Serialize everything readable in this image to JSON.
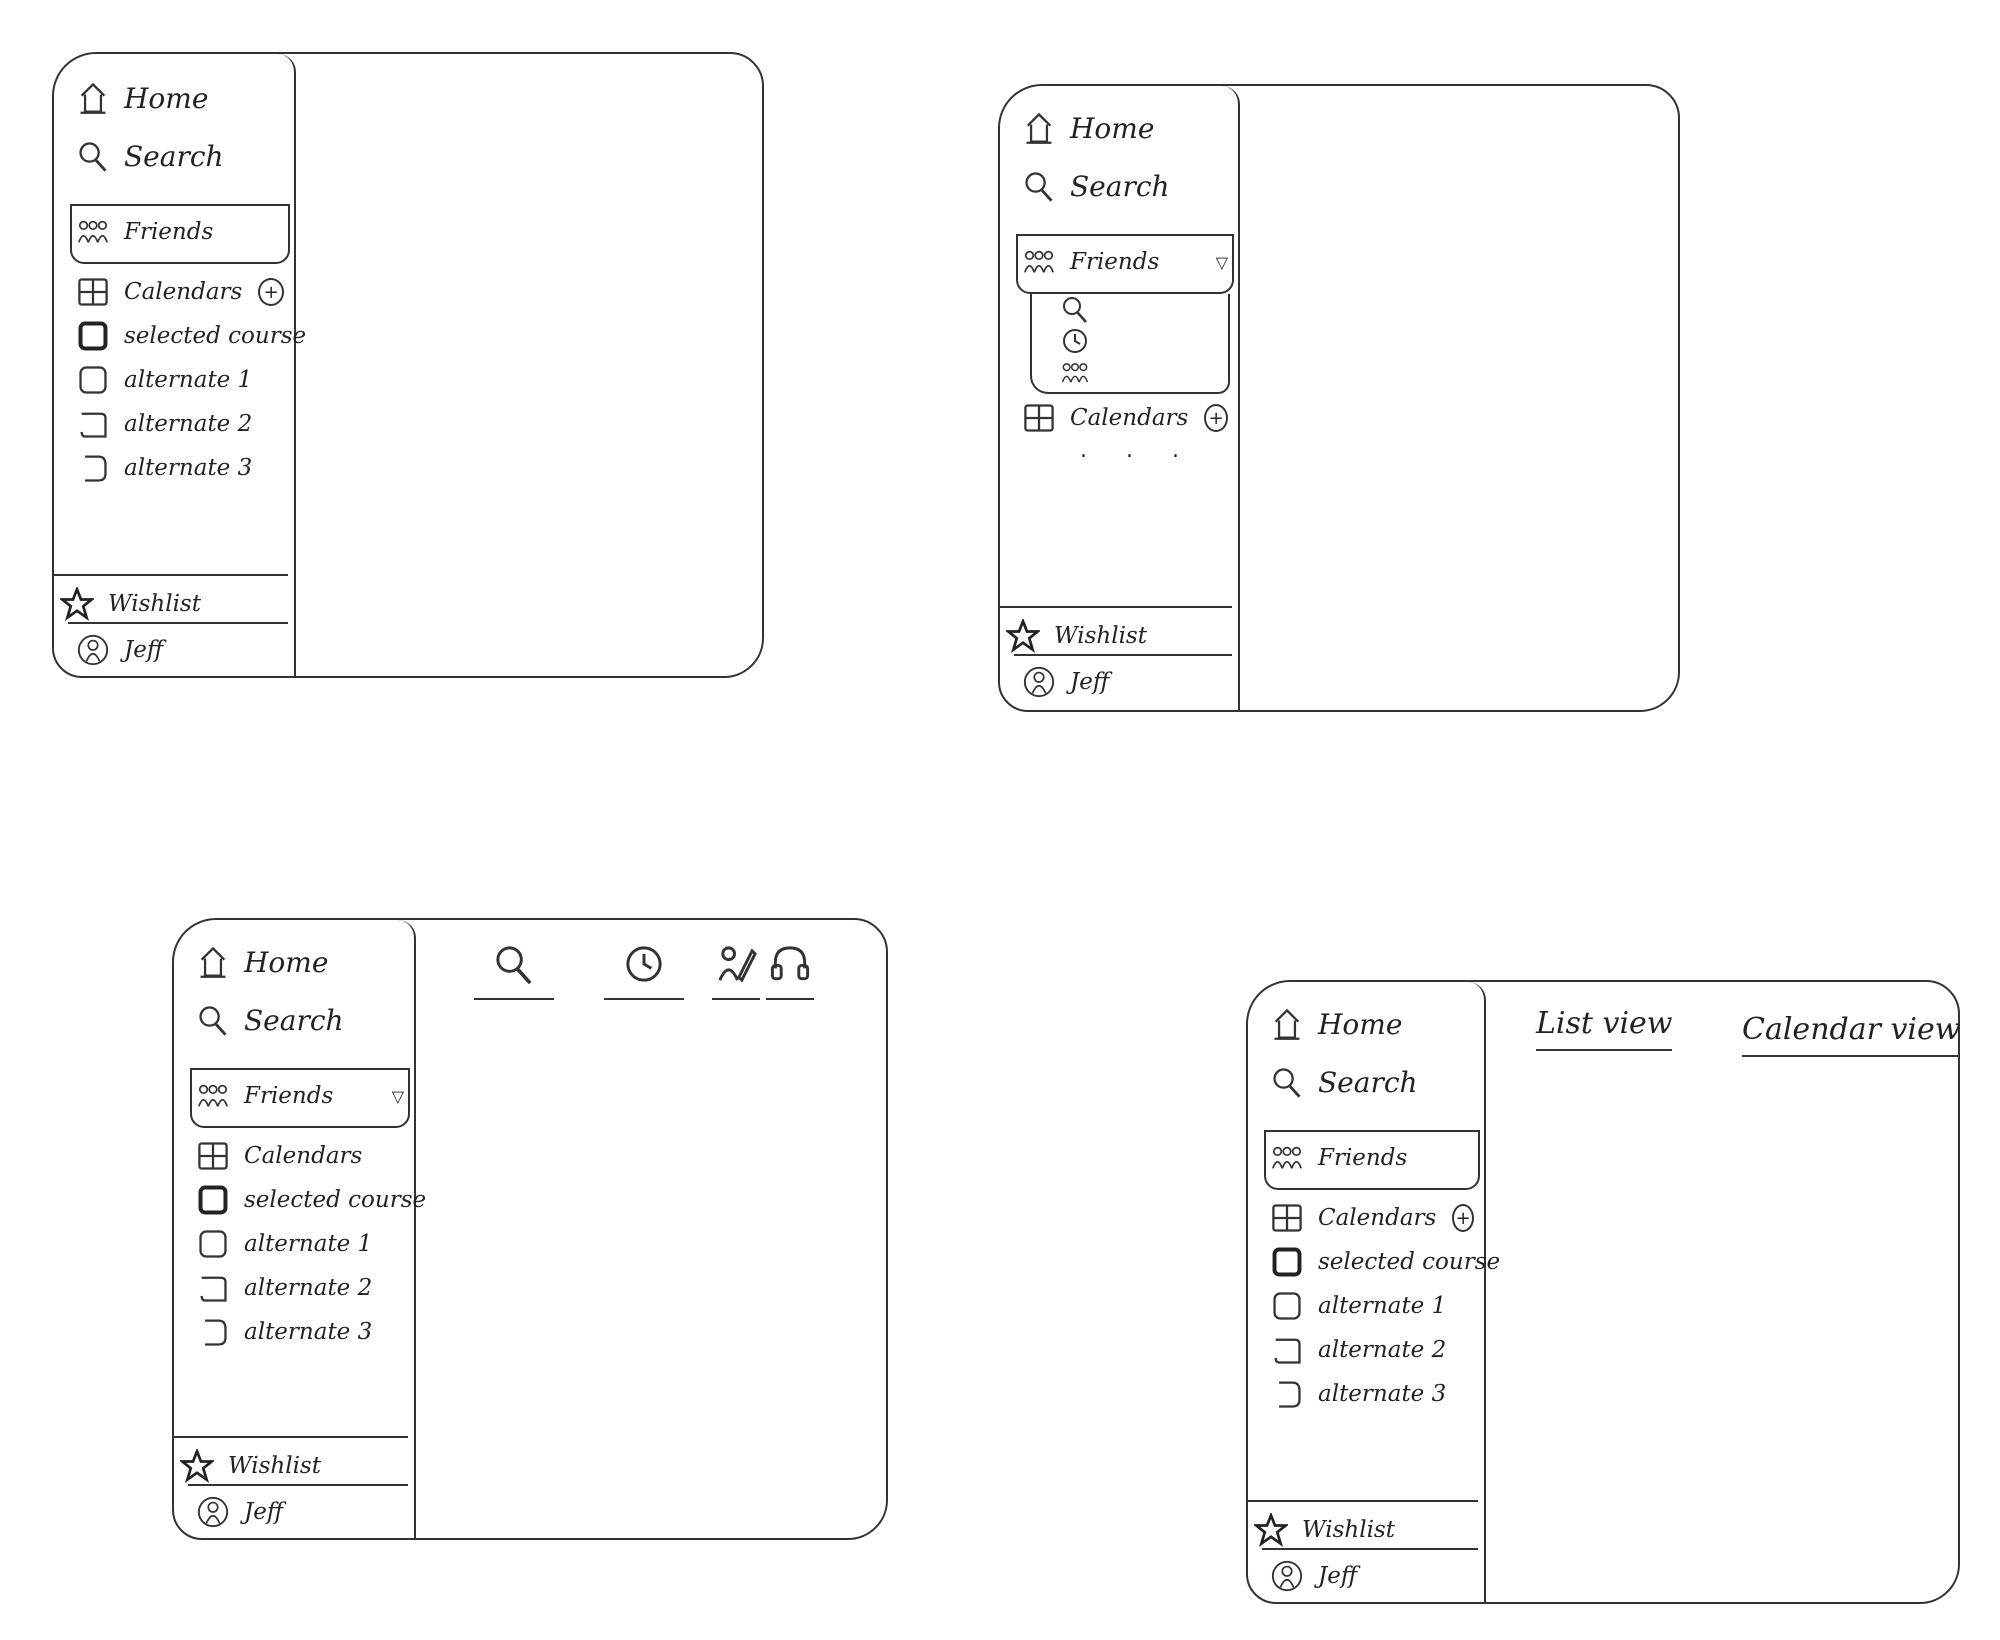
{
  "sidebar": {
    "home_label": "Home",
    "search_label": "Search",
    "friends_label": "Friends",
    "calendar_label": "Calendars",
    "selected_course_label": "selected course",
    "alternates": [
      "alternate 1",
      "alternate 2",
      "alternate 3"
    ],
    "wishlist_label": "Wishlist",
    "user_name": "Jeff"
  },
  "content_tabs": {
    "list_view_label": "List view",
    "calendar_view_label": "Calendar view"
  },
  "icons": [
    "home-icon",
    "search-icon",
    "friends-icon",
    "calendar-icon",
    "course-icon",
    "star-icon",
    "avatar-icon",
    "clock-icon",
    "plus-icon"
  ]
}
